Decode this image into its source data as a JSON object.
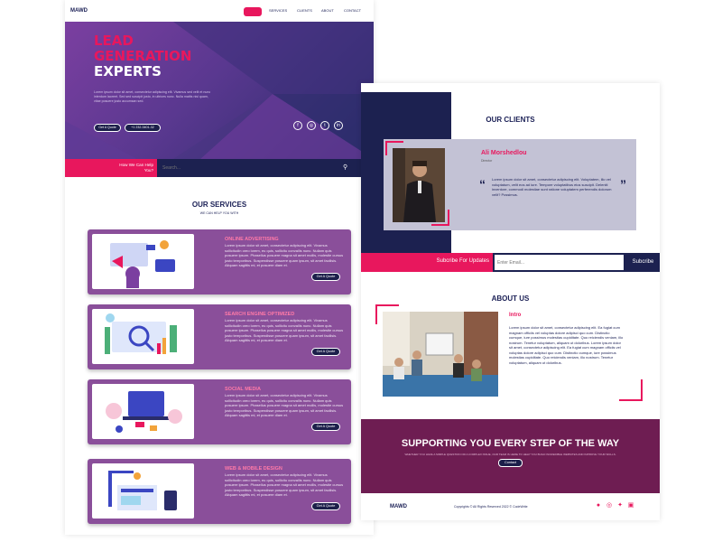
{
  "nav": {
    "logo": "MAWD",
    "items": [
      "HOME",
      "SERVICES",
      "CLIENTS",
      "ABOUT",
      "CONTACT"
    ]
  },
  "hero": {
    "title_line1": "LEAD",
    "title_line2": "GENERATION",
    "title_line3": "EXPERTS",
    "body": "Lorem ipsum dolor sit amet, consectetur adipiscing elit. Vivamus sed velit et nunc interdum laoreet. Sed sed suscipit justo, in ultrices nunc. Nulla mattis nisl quam, vitae posuere justo accumsan sed.",
    "quote_button": "Get A Quote",
    "phone_button": "+1 232-3401-32",
    "social_icons": [
      "facebook-icon",
      "instagram-icon",
      "twitter-icon",
      "linkedin-icon"
    ]
  },
  "help": {
    "label": "How We Can Help You?",
    "search_placeholder": "Search..."
  },
  "services": {
    "title": "OUR SERVICES",
    "subtitle": "WE CAN HELP YOU WITH",
    "items": [
      {
        "title": "ONLINE ADVERTISING",
        "text": "Lorem ipsum dolor sit amet, consectetur adipiscing elit. Vivamus sollicitudin oreo lorem, eu quis, sollicitu convallis nunc. Nullam quis posuere ipsum. Phasellus posuere magna sit amet mollis, molestie cursus justo temporibus. Suspendisse posuere quam ipsum, sit amet facilisis. Aliquam sagittis mi, et posuere diam et.",
        "button": "Get A Quote"
      },
      {
        "title": "SEARCH ENGINE OPTIMIZED",
        "text": "Lorem ipsum dolor sit amet, consectetur adipiscing elit. Vivamus sollicitudin oreo lorem, eu quis, sollicitu convallis nunc. Nullam quis posuere ipsum. Phasellus posuere magna sit amet mollis, molestie cursus justo temporibus. Suspendisse posuere quam ipsum, sit amet facilisis. Aliquam sagittis mi, et posuere diam et.",
        "button": "Get A Quote"
      },
      {
        "title": "SOCIAL MEDIA",
        "text": "Lorem ipsum dolor sit amet, consectetur adipiscing elit. Vivamus sollicitudin oreo lorem, eu quis, sollicitu convallis nunc. Nullam quis posuere ipsum. Phasellus posuere magna sit amet mollis, molestie cursus justo temporibus. Suspendisse posuere quam ipsum, sit amet facilisis. Aliquam sagittis mi, et posuere diam et.",
        "button": "Get A Quote"
      },
      {
        "title": "WEB & MOBILE DESIGN",
        "text": "Lorem ipsum dolor sit amet, consectetur adipiscing elit. Vivamus sollicitudin oreo lorem, eu quis, sollicitu convallis nunc. Nullam quis posuere ipsum. Phasellus posuere magna sit amet mollis, molestie cursus justo temporibus. Suspendisse posuere quam ipsum, sit amet facilisis. Aliquam sagittis mi, et posuere diam et.",
        "button": "Get A Quote"
      }
    ]
  },
  "clients": {
    "title": "OUR CLIENTS",
    "name": "Ali Morshedlou",
    "role": "Director",
    "quote": "Lorem ipsum dolor sit amet, consectetur adipiscing elit. Voluptatem, illo vel voluptatum, velit eos ad iure. Tempore voluptatibus eius suscipit. Deleniti inventore, commodi molestiae sunt ratione voluptatem perferendis dolorum velit? Possimus.",
    "open_quote": "“",
    "close_quote": "”"
  },
  "subscribe": {
    "label": "Subcribe For Updates",
    "placeholder": "Enter Email...",
    "button": "Subcribe"
  },
  "about": {
    "title": "ABOUT US",
    "heading": "Intro",
    "text": "Lorem ipsum dolor sit amet, consectetur adipiscing elit. Ea fugiat cum magnam officiis vel voluptas dolore adipisci quo cum. Distinctio cumque, iure possimus molestias cupiditate. Quo reiciendis veniam, illo nostrum. Tenetur voluptatum, aliquam ut doloribus. Lorem ipsum dolor sit amet, consectetur adipiscing elit. Ea fugiat cum magnam officiis vel voluptas dolore adipisci quo cum. Distinctio cumque, iure possimus molestias cupiditate. Quo reiciendis veniam, illo nostrum. Tenetur voluptatum, aliquam ut doloribus."
  },
  "support": {
    "title": "SUPPORTING YOU EVERY STEP OF THE WAY",
    "subtitle": "WHETHER YOU HAVE A SIMPLE QUESTION OR A COMPLEX ISSUE, OUR TEAM IS HERE TO HELP YOU BUILD INCREDIBLE WEBSITES AND IMPROVE YOUR SKILLS.",
    "button": "Contact"
  },
  "footer": {
    "logo": "MAWD",
    "copyright": "Copyrights © All Rights Reserved 2022 © CodeWrite",
    "social_icons": [
      "facebook-icon",
      "instagram-icon",
      "twitter-icon",
      "linkedin-icon"
    ]
  },
  "colors": {
    "accent": "#e8175d",
    "navy": "#1c2150",
    "card": "#8a4f9a",
    "support": "#6e1d52"
  }
}
